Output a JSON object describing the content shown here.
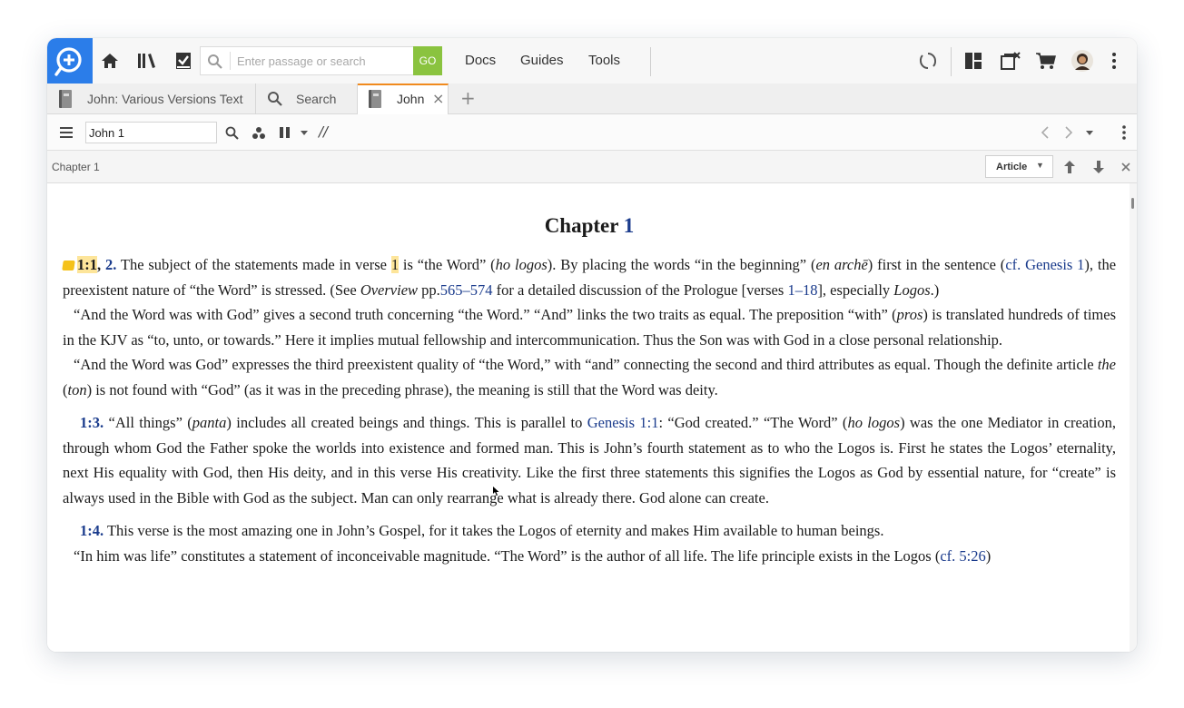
{
  "toolbar": {
    "search_placeholder": "Enter passage or search",
    "go_label": "GO",
    "menus": [
      "Docs",
      "Guides",
      "Tools"
    ]
  },
  "tabs": [
    {
      "label": "John: Various Versions Text",
      "icon": "book-icon"
    },
    {
      "label": "Search",
      "icon": "search-icon"
    },
    {
      "label": "John",
      "icon": "book-icon",
      "active": true,
      "close": "×"
    }
  ],
  "panel": {
    "reference": "John 1",
    "parallel_mark": "//"
  },
  "chapter_bar": {
    "label": "Chapter 1",
    "view_mode": "Article"
  },
  "content": {
    "title_word": "Chapter",
    "title_num": "1",
    "p1": {
      "ref1": "1:1",
      "comma": ",",
      "ref2": "2.",
      "t1": " The subject of the statements made in verse ",
      "verse": "1",
      "t2": " is “the Word” (",
      "i1": "ho logos",
      "t3": "). By placing the words “in the beginning” (",
      "i2": "en archē",
      "t4": ") first in the sentence (",
      "link1": "cf. Genesis 1",
      "t5": "), the preexistent nature of “the Word” is stressed. (See ",
      "i3": "Overview",
      "t6": " pp.",
      "link2": "565–574",
      "t7": " for a detailed discussion of the Prologue [verses ",
      "link3": "1–18",
      "t8": "], especially ",
      "i4": "Logos",
      "t9": ".)"
    },
    "p2": {
      "t1": "“And the Word was with God” gives a second truth concerning “the Word.” “And” links the two traits as equal. The preposition “with” (",
      "i1": "pros",
      "t2": ") is translated hundreds of times in the KJV as “to, unto, or towards.” Here it implies mutual fellowship and intercommunication. Thus the Son was with God in a close personal relationship."
    },
    "p3": {
      "t1": "“And the Word was God” expresses the third preexistent quality of “the Word,” with “and” connecting the second and third attributes as equal. Though the definite article ",
      "i1": "the",
      "t2": " (",
      "i2": "ton",
      "t3": ") is not found with “God” (as it was in the preceding phrase), the meaning is still that the Word was deity."
    },
    "p4": {
      "ref": "1:3.",
      "t1": " “All things” (",
      "i1": "panta",
      "t2": ") includes all created beings and things. This is parallel to ",
      "link1": "Genesis 1:1",
      "t3": ": “God created.” “The Word” (",
      "i2": "ho logos",
      "t4": ") was the one Mediator in creation, through whom God the Father spoke the worlds into existence and formed man. This is John’s fourth statement as to who the Logos is. First he states the Logos’ eternality, next His equality with God, then His deity, and in this verse His creativity. Like the first three statements this signifies the Logos as God by essential nature, for “create” is always used in the Bible with God as the subject. Man can only rearrange what is already there. God alone can create."
    },
    "p5": {
      "ref": "1:4.",
      "t1": " This verse is the most amazing one in John’s Gospel, for it takes the Logos of eternity and makes Him available to human beings."
    },
    "p6": {
      "t1": "“In him was life” constitutes a statement of inconceivable magnitude. “The Word” is the author of all life. The life principle exists in the Logos (",
      "link1": "cf. 5:26",
      "t2": ")"
    }
  }
}
